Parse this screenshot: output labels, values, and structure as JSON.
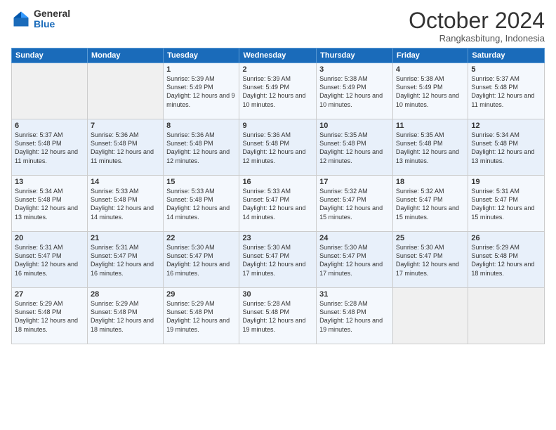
{
  "logo": {
    "general": "General",
    "blue": "Blue"
  },
  "header": {
    "month": "October 2024",
    "location": "Rangkasbitung, Indonesia"
  },
  "weekdays": [
    "Sunday",
    "Monday",
    "Tuesday",
    "Wednesday",
    "Thursday",
    "Friday",
    "Saturday"
  ],
  "weeks": [
    [
      {
        "day": "",
        "sunrise": "",
        "sunset": "",
        "daylight": ""
      },
      {
        "day": "",
        "sunrise": "",
        "sunset": "",
        "daylight": ""
      },
      {
        "day": "1",
        "sunrise": "Sunrise: 5:39 AM",
        "sunset": "Sunset: 5:49 PM",
        "daylight": "Daylight: 12 hours and 9 minutes."
      },
      {
        "day": "2",
        "sunrise": "Sunrise: 5:39 AM",
        "sunset": "Sunset: 5:49 PM",
        "daylight": "Daylight: 12 hours and 10 minutes."
      },
      {
        "day": "3",
        "sunrise": "Sunrise: 5:38 AM",
        "sunset": "Sunset: 5:49 PM",
        "daylight": "Daylight: 12 hours and 10 minutes."
      },
      {
        "day": "4",
        "sunrise": "Sunrise: 5:38 AM",
        "sunset": "Sunset: 5:49 PM",
        "daylight": "Daylight: 12 hours and 10 minutes."
      },
      {
        "day": "5",
        "sunrise": "Sunrise: 5:37 AM",
        "sunset": "Sunset: 5:48 PM",
        "daylight": "Daylight: 12 hours and 11 minutes."
      }
    ],
    [
      {
        "day": "6",
        "sunrise": "Sunrise: 5:37 AM",
        "sunset": "Sunset: 5:48 PM",
        "daylight": "Daylight: 12 hours and 11 minutes."
      },
      {
        "day": "7",
        "sunrise": "Sunrise: 5:36 AM",
        "sunset": "Sunset: 5:48 PM",
        "daylight": "Daylight: 12 hours and 11 minutes."
      },
      {
        "day": "8",
        "sunrise": "Sunrise: 5:36 AM",
        "sunset": "Sunset: 5:48 PM",
        "daylight": "Daylight: 12 hours and 12 minutes."
      },
      {
        "day": "9",
        "sunrise": "Sunrise: 5:36 AM",
        "sunset": "Sunset: 5:48 PM",
        "daylight": "Daylight: 12 hours and 12 minutes."
      },
      {
        "day": "10",
        "sunrise": "Sunrise: 5:35 AM",
        "sunset": "Sunset: 5:48 PM",
        "daylight": "Daylight: 12 hours and 12 minutes."
      },
      {
        "day": "11",
        "sunrise": "Sunrise: 5:35 AM",
        "sunset": "Sunset: 5:48 PM",
        "daylight": "Daylight: 12 hours and 13 minutes."
      },
      {
        "day": "12",
        "sunrise": "Sunrise: 5:34 AM",
        "sunset": "Sunset: 5:48 PM",
        "daylight": "Daylight: 12 hours and 13 minutes."
      }
    ],
    [
      {
        "day": "13",
        "sunrise": "Sunrise: 5:34 AM",
        "sunset": "Sunset: 5:48 PM",
        "daylight": "Daylight: 12 hours and 13 minutes."
      },
      {
        "day": "14",
        "sunrise": "Sunrise: 5:33 AM",
        "sunset": "Sunset: 5:48 PM",
        "daylight": "Daylight: 12 hours and 14 minutes."
      },
      {
        "day": "15",
        "sunrise": "Sunrise: 5:33 AM",
        "sunset": "Sunset: 5:48 PM",
        "daylight": "Daylight: 12 hours and 14 minutes."
      },
      {
        "day": "16",
        "sunrise": "Sunrise: 5:33 AM",
        "sunset": "Sunset: 5:47 PM",
        "daylight": "Daylight: 12 hours and 14 minutes."
      },
      {
        "day": "17",
        "sunrise": "Sunrise: 5:32 AM",
        "sunset": "Sunset: 5:47 PM",
        "daylight": "Daylight: 12 hours and 15 minutes."
      },
      {
        "day": "18",
        "sunrise": "Sunrise: 5:32 AM",
        "sunset": "Sunset: 5:47 PM",
        "daylight": "Daylight: 12 hours and 15 minutes."
      },
      {
        "day": "19",
        "sunrise": "Sunrise: 5:31 AM",
        "sunset": "Sunset: 5:47 PM",
        "daylight": "Daylight: 12 hours and 15 minutes."
      }
    ],
    [
      {
        "day": "20",
        "sunrise": "Sunrise: 5:31 AM",
        "sunset": "Sunset: 5:47 PM",
        "daylight": "Daylight: 12 hours and 16 minutes."
      },
      {
        "day": "21",
        "sunrise": "Sunrise: 5:31 AM",
        "sunset": "Sunset: 5:47 PM",
        "daylight": "Daylight: 12 hours and 16 minutes."
      },
      {
        "day": "22",
        "sunrise": "Sunrise: 5:30 AM",
        "sunset": "Sunset: 5:47 PM",
        "daylight": "Daylight: 12 hours and 16 minutes."
      },
      {
        "day": "23",
        "sunrise": "Sunrise: 5:30 AM",
        "sunset": "Sunset: 5:47 PM",
        "daylight": "Daylight: 12 hours and 17 minutes."
      },
      {
        "day": "24",
        "sunrise": "Sunrise: 5:30 AM",
        "sunset": "Sunset: 5:47 PM",
        "daylight": "Daylight: 12 hours and 17 minutes."
      },
      {
        "day": "25",
        "sunrise": "Sunrise: 5:30 AM",
        "sunset": "Sunset: 5:47 PM",
        "daylight": "Daylight: 12 hours and 17 minutes."
      },
      {
        "day": "26",
        "sunrise": "Sunrise: 5:29 AM",
        "sunset": "Sunset: 5:48 PM",
        "daylight": "Daylight: 12 hours and 18 minutes."
      }
    ],
    [
      {
        "day": "27",
        "sunrise": "Sunrise: 5:29 AM",
        "sunset": "Sunset: 5:48 PM",
        "daylight": "Daylight: 12 hours and 18 minutes."
      },
      {
        "day": "28",
        "sunrise": "Sunrise: 5:29 AM",
        "sunset": "Sunset: 5:48 PM",
        "daylight": "Daylight: 12 hours and 18 minutes."
      },
      {
        "day": "29",
        "sunrise": "Sunrise: 5:29 AM",
        "sunset": "Sunset: 5:48 PM",
        "daylight": "Daylight: 12 hours and 19 minutes."
      },
      {
        "day": "30",
        "sunrise": "Sunrise: 5:28 AM",
        "sunset": "Sunset: 5:48 PM",
        "daylight": "Daylight: 12 hours and 19 minutes."
      },
      {
        "day": "31",
        "sunrise": "Sunrise: 5:28 AM",
        "sunset": "Sunset: 5:48 PM",
        "daylight": "Daylight: 12 hours and 19 minutes."
      },
      {
        "day": "",
        "sunrise": "",
        "sunset": "",
        "daylight": ""
      },
      {
        "day": "",
        "sunrise": "",
        "sunset": "",
        "daylight": ""
      }
    ]
  ]
}
